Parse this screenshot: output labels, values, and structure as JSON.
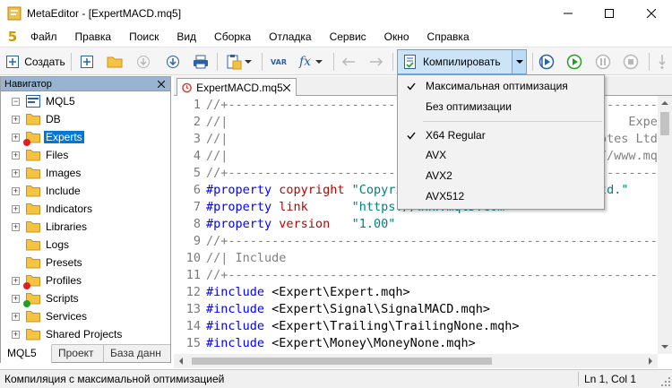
{
  "window": {
    "title": "MetaEditor - [ExpertMACD.mq5]"
  },
  "menu": {
    "logo": "5",
    "items": [
      "Файл",
      "Правка",
      "Поиск",
      "Вид",
      "Сборка",
      "Отладка",
      "Сервис",
      "Окно",
      "Справка"
    ]
  },
  "toolbar": {
    "create_label": "Создать",
    "var_label": "VAR",
    "fx_label": "fx",
    "compile_label": "Компилировать"
  },
  "compile_menu": {
    "items": [
      {
        "label": "Максимальная оптимизация",
        "checked": true
      },
      {
        "label": "Без оптимизации",
        "checked": false
      },
      {
        "label": "X64 Regular",
        "checked": true
      },
      {
        "label": "AVX",
        "checked": false
      },
      {
        "label": "AVX2",
        "checked": false
      },
      {
        "label": "AVX512",
        "checked": false
      }
    ]
  },
  "navigator": {
    "title": "Навигатор",
    "root": "MQL5",
    "items": [
      {
        "label": "DB",
        "expander": true,
        "badge": null,
        "selected": false
      },
      {
        "label": "Experts",
        "expander": true,
        "badge": "#e02020",
        "selected": true
      },
      {
        "label": "Files",
        "expander": true,
        "badge": null,
        "selected": false
      },
      {
        "label": "Images",
        "expander": true,
        "badge": null,
        "selected": false
      },
      {
        "label": "Include",
        "expander": true,
        "badge": null,
        "selected": false
      },
      {
        "label": "Indicators",
        "expander": true,
        "badge": null,
        "selected": false
      },
      {
        "label": "Libraries",
        "expander": true,
        "badge": null,
        "selected": false
      },
      {
        "label": "Logs",
        "expander": false,
        "badge": null,
        "selected": false
      },
      {
        "label": "Presets",
        "expander": false,
        "badge": null,
        "selected": false
      },
      {
        "label": "Profiles",
        "expander": true,
        "badge": "#e02020",
        "selected": false
      },
      {
        "label": "Scripts",
        "expander": true,
        "badge": "#22a022",
        "selected": false
      },
      {
        "label": "Services",
        "expander": true,
        "badge": null,
        "selected": false
      },
      {
        "label": "Shared Projects",
        "expander": true,
        "badge": null,
        "selected": false
      }
    ],
    "tabs": [
      "MQL5",
      "Проект",
      "База данн"
    ]
  },
  "editor": {
    "tab_label": "ExpertMACD.mq5",
    "lines": [
      {
        "n": "1",
        "parts": [
          [
            "c-comment",
            "//+------------------------------------------------------------------+"
          ]
        ]
      },
      {
        "n": "2",
        "parts": [
          [
            "c-comment",
            "//|                                                       ExpertMACD.mq5 |"
          ]
        ]
      },
      {
        "n": "3",
        "parts": [
          [
            "c-comment",
            "//|                        Copyright 2000-2023, MetaQuotes Ltd. |"
          ]
        ]
      },
      {
        "n": "4",
        "parts": [
          [
            "c-comment",
            "//|                                             https://www.mql5.com |"
          ]
        ]
      },
      {
        "n": "5",
        "parts": [
          [
            "c-comment",
            "//+------------------------------------------------------------------+"
          ]
        ]
      },
      {
        "n": "6",
        "parts": [
          [
            "c-dir",
            "#property"
          ],
          [
            "c-text",
            " "
          ],
          [
            "c-kw",
            "copyright"
          ],
          [
            "c-text",
            " "
          ],
          [
            "c-str",
            "\"Copyright 2000-2023, MetaQuotes Ltd.\""
          ]
        ]
      },
      {
        "n": "7",
        "parts": [
          [
            "c-dir",
            "#property"
          ],
          [
            "c-text",
            " "
          ],
          [
            "c-kw",
            "link"
          ],
          [
            "c-text",
            "      "
          ],
          [
            "c-str",
            "\"https://www.mql5.com\""
          ]
        ]
      },
      {
        "n": "8",
        "parts": [
          [
            "c-dir",
            "#property"
          ],
          [
            "c-text",
            " "
          ],
          [
            "c-kw",
            "version"
          ],
          [
            "c-text",
            "   "
          ],
          [
            "c-str",
            "\"1.00\""
          ]
        ]
      },
      {
        "n": "9",
        "parts": [
          [
            "c-comment",
            "//+------------------------------------------------------------------+"
          ]
        ]
      },
      {
        "n": "10",
        "parts": [
          [
            "c-comment",
            "//| Include                                                          |"
          ]
        ]
      },
      {
        "n": "11",
        "parts": [
          [
            "c-comment",
            "//+------------------------------------------------------------------+"
          ]
        ]
      },
      {
        "n": "12",
        "parts": [
          [
            "c-dir",
            "#include"
          ],
          [
            "c-text",
            " <Expert\\Expert.mqh>"
          ]
        ]
      },
      {
        "n": "13",
        "parts": [
          [
            "c-dir",
            "#include"
          ],
          [
            "c-text",
            " <Expert\\Signal\\SignalMACD.mqh>"
          ]
        ]
      },
      {
        "n": "14",
        "parts": [
          [
            "c-dir",
            "#include"
          ],
          [
            "c-text",
            " <Expert\\Trailing\\TrailingNone.mqh>"
          ]
        ]
      },
      {
        "n": "15",
        "parts": [
          [
            "c-dir",
            "#include"
          ],
          [
            "c-text",
            " <Expert\\Money\\MoneyNone.mqh>"
          ]
        ]
      }
    ]
  },
  "status": {
    "text": "Компиляция с максимальной оптимизацией",
    "position": "Ln 1, Col 1"
  },
  "colors": {
    "selection": "#0078d7",
    "compile_button": "#cce4f7",
    "navigator_header": "#99b4d1",
    "folder": "#f5c242"
  }
}
